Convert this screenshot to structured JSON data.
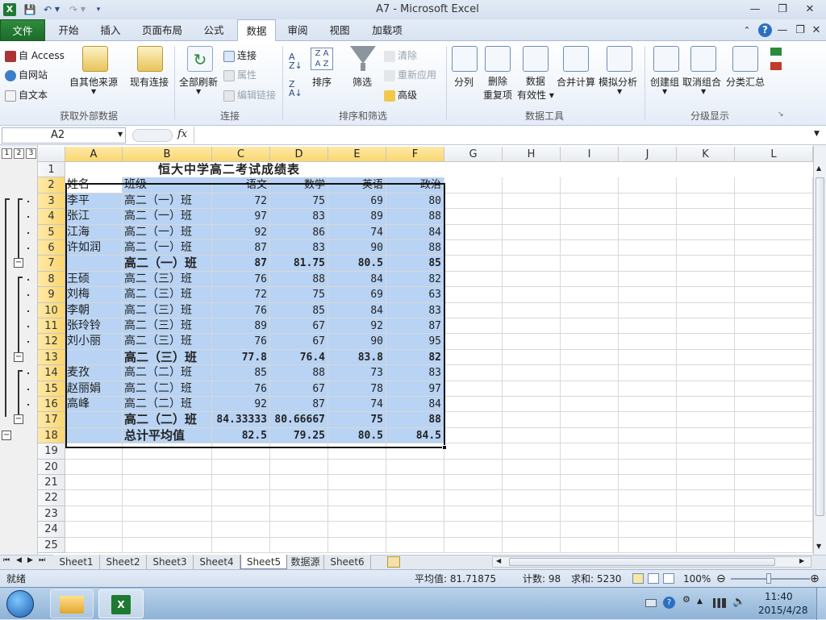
{
  "window": {
    "title": "A7 - Microsoft Excel"
  },
  "tabs": [
    "文件",
    "开始",
    "插入",
    "页面布局",
    "公式",
    "数据",
    "审阅",
    "视图",
    "加载项"
  ],
  "ribbon": {
    "ext": {
      "access": "自 Access",
      "web": "自网站",
      "text": "自文本",
      "other": "自其他来源",
      "existing": "现有连接",
      "label": "获取外部数据"
    },
    "conn": {
      "refresh": "全部刷新",
      "connections": "连接",
      "properties": "属性",
      "edit_links": "编辑链接",
      "label": "连接"
    },
    "sort": {
      "sort": "排序",
      "filter": "筛选",
      "clear": "清除",
      "reapply": "重新应用",
      "advanced": "高级",
      "label": "排序和筛选"
    },
    "tools": {
      "split": "分列",
      "remove_dup": "删除",
      "remove_dup2": "重复项",
      "validation": "数据",
      "validation2": "有效性",
      "consolidate": "合并计算",
      "whatif": "模拟分析",
      "label": "数据工具"
    },
    "outline": {
      "group": "创建组",
      "ungroup": "取消组合",
      "subtotal": "分类汇总",
      "label": "分级显示"
    }
  },
  "formula": {
    "namebox": "A2",
    "fx": "fx",
    "value": ""
  },
  "columns": [
    "A",
    "B",
    "C",
    "D",
    "E",
    "F",
    "G",
    "H",
    "I",
    "J",
    "K",
    "L"
  ],
  "outline_levels": [
    "1",
    "2",
    "3"
  ],
  "rows": [
    {
      "n": "1",
      "a": "",
      "b": "恒大中学高二考试成绩表",
      "c": "",
      "d": "",
      "e": "",
      "f": "",
      "title": true
    },
    {
      "n": "2",
      "a": "姓名",
      "b": "班级",
      "c": "语文",
      "d": "数学",
      "e": "英语",
      "f": "政治",
      "header": true
    },
    {
      "n": "3",
      "a": "李平",
      "b": "高二（一）班",
      "c": "72",
      "d": "75",
      "e": "69",
      "f": "80"
    },
    {
      "n": "4",
      "a": "张江",
      "b": "高二（一）班",
      "c": "97",
      "d": "83",
      "e": "89",
      "f": "88"
    },
    {
      "n": "5",
      "a": "江海",
      "b": "高二（一）班",
      "c": "92",
      "d": "86",
      "e": "74",
      "f": "84"
    },
    {
      "n": "6",
      "a": "许如润",
      "b": "高二（一）班",
      "c": "87",
      "d": "83",
      "e": "90",
      "f": "88"
    },
    {
      "n": "7",
      "a": "",
      "b": "高二（一）班",
      "c": "87",
      "d": "81.75",
      "e": "80.5",
      "f": "85",
      "bold": true
    },
    {
      "n": "8",
      "a": "王硕",
      "b": "高二（三）班",
      "c": "76",
      "d": "88",
      "e": "84",
      "f": "82"
    },
    {
      "n": "9",
      "a": "刘梅",
      "b": "高二（三）班",
      "c": "72",
      "d": "75",
      "e": "69",
      "f": "63"
    },
    {
      "n": "10",
      "a": "李朝",
      "b": "高二（三）班",
      "c": "76",
      "d": "85",
      "e": "84",
      "f": "83"
    },
    {
      "n": "11",
      "a": "张玲铃",
      "b": "高二（三）班",
      "c": "89",
      "d": "67",
      "e": "92",
      "f": "87"
    },
    {
      "n": "12",
      "a": "刘小丽",
      "b": "高二（三）班",
      "c": "76",
      "d": "67",
      "e": "90",
      "f": "95"
    },
    {
      "n": "13",
      "a": "",
      "b": "高二（三）班",
      "c": "77.8",
      "d": "76.4",
      "e": "83.8",
      "f": "82",
      "bold": true
    },
    {
      "n": "14",
      "a": "麦孜",
      "b": "高二（二）班",
      "c": "85",
      "d": "88",
      "e": "73",
      "f": "83"
    },
    {
      "n": "15",
      "a": "赵丽娟",
      "b": "高二（二）班",
      "c": "76",
      "d": "67",
      "e": "78",
      "f": "97"
    },
    {
      "n": "16",
      "a": "高峰",
      "b": "高二（二）班",
      "c": "92",
      "d": "87",
      "e": "74",
      "f": "84"
    },
    {
      "n": "17",
      "a": "",
      "b": "高二（二）班",
      "c": "84.33333",
      "d": "80.66667",
      "e": "75",
      "f": "88",
      "bold": true
    },
    {
      "n": "18",
      "a": "",
      "b": "总计平均值",
      "c": "82.5",
      "d": "79.25",
      "e": "80.5",
      "f": "84.5",
      "bold": true
    },
    {
      "n": "19"
    },
    {
      "n": "20"
    },
    {
      "n": "21"
    },
    {
      "n": "22"
    },
    {
      "n": "23"
    },
    {
      "n": "24"
    },
    {
      "n": "25"
    }
  ],
  "sheets": [
    "Sheet1",
    "Sheet2",
    "Sheet3",
    "Sheet4",
    "Sheet5",
    "数据源",
    "Sheet6"
  ],
  "active_sheet": "Sheet5",
  "status": {
    "ready": "就绪",
    "average": "平均值: 81.71875",
    "count": "计数: 98",
    "sum": "求和: 5230",
    "zoom": "100%"
  },
  "clock": {
    "time": "11:40",
    "date": "2015/4/28"
  },
  "colors": {
    "accent": "#1e7a32",
    "selection": "#b8d3f3",
    "header_sel": "#f9d66e"
  }
}
